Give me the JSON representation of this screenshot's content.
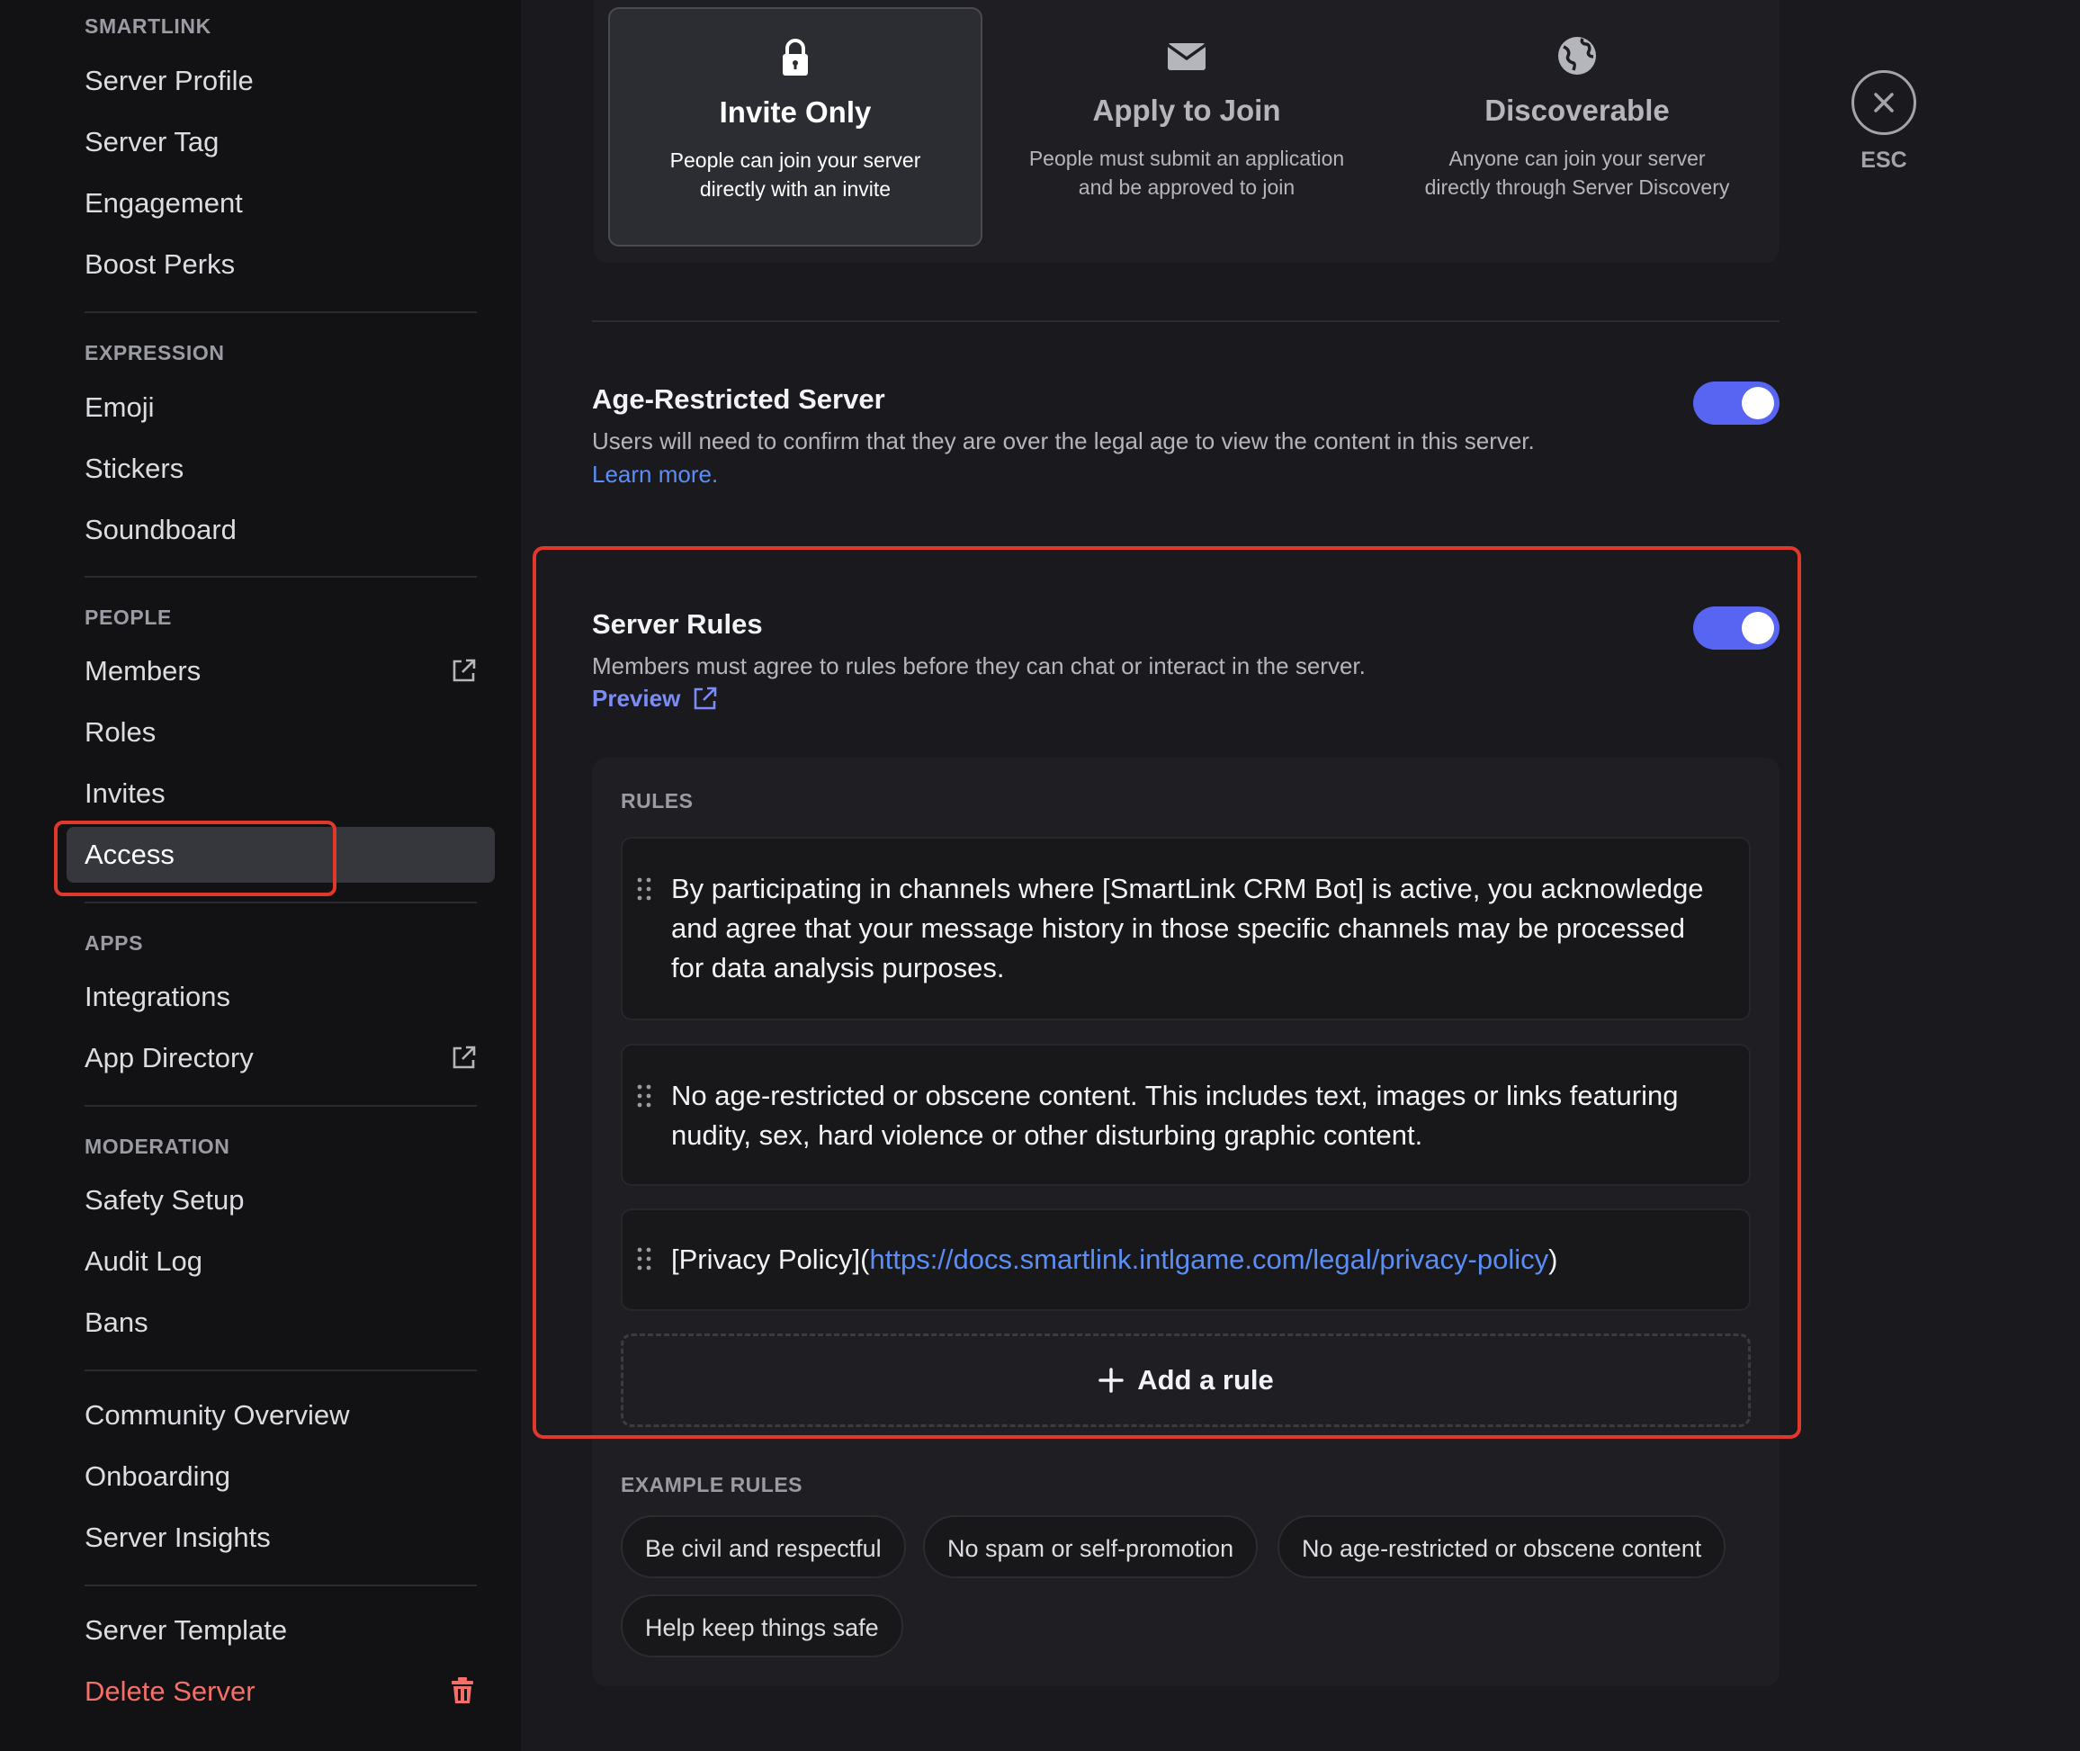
{
  "sidebar": {
    "sections": [
      {
        "header": "SMARTLINK",
        "items": [
          "Server Profile",
          "Server Tag",
          "Engagement",
          "Boost Perks"
        ]
      },
      {
        "header": "EXPRESSION",
        "items": [
          "Emoji",
          "Stickers",
          "Soundboard"
        ]
      },
      {
        "header": "PEOPLE",
        "items": [
          "Members",
          "Roles",
          "Invites",
          "Access"
        ]
      },
      {
        "header": "APPS",
        "items": [
          "Integrations",
          "App Directory"
        ]
      },
      {
        "header": "MODERATION",
        "items": [
          "Safety Setup",
          "Audit Log",
          "Bans"
        ]
      },
      {
        "header": "",
        "items": [
          "Community Overview",
          "Onboarding",
          "Server Insights"
        ]
      },
      {
        "header": "",
        "items": [
          "Server Template",
          "Delete Server"
        ]
      }
    ],
    "active_item": "Access"
  },
  "access_options": [
    {
      "title": "Invite Only",
      "desc": "People can join your server directly with an invite",
      "icon": "lock-icon",
      "selected": true
    },
    {
      "title": "Apply to Join",
      "desc": "People must submit an application and be approved to join",
      "icon": "envelope-icon",
      "selected": false
    },
    {
      "title": "Discoverable",
      "desc": "Anyone can join your server directly through Server Discovery",
      "icon": "globe-icon",
      "selected": false
    }
  ],
  "age_restricted": {
    "title": "Age-Restricted Server",
    "desc": "Users will need to confirm that they are over the legal age to view the content in this server.",
    "link": "Learn more.",
    "enabled": true
  },
  "server_rules": {
    "title": "Server Rules",
    "desc": "Members must agree to rules before they can chat or interact in the server.",
    "preview_label": "Preview",
    "enabled": true,
    "rules_label": "RULES",
    "rules": [
      "By participating in channels where [SmartLink CRM Bot] is active, you acknowledge and agree that your message history in those specific channels may be processed for data analysis purposes.",
      "No age-restricted or obscene content. This includes text, images or links featuring nudity, sex, hard violence or other disturbing graphic content."
    ],
    "privacy_rule": {
      "prefix": "[Privacy Policy](",
      "url": "https://docs.smartlink.intlgame.com/legal/privacy-policy",
      "suffix": ")"
    },
    "add_rule_label": "Add a rule",
    "example_label": "EXAMPLE RULES",
    "examples": [
      "Be civil and respectful",
      "No spam or self-promotion",
      "No age-restricted or obscene content",
      "Help keep things safe"
    ]
  },
  "esc_label": "ESC",
  "colors": {
    "accent": "#5865f2",
    "danger": "#f36f68",
    "link": "#5b8ef5",
    "highlight": "#e0382b"
  }
}
